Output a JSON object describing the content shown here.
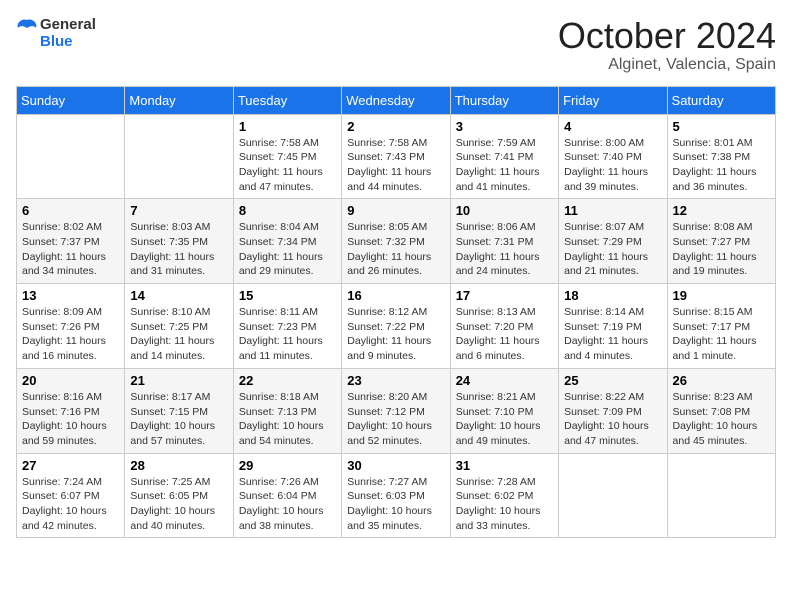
{
  "logo": {
    "text_general": "General",
    "text_blue": "Blue"
  },
  "header": {
    "month": "October 2024",
    "location": "Alginet, Valencia, Spain"
  },
  "weekdays": [
    "Sunday",
    "Monday",
    "Tuesday",
    "Wednesday",
    "Thursday",
    "Friday",
    "Saturday"
  ],
  "weeks": [
    [
      {
        "day": "",
        "sunrise": "",
        "sunset": "",
        "daylight": ""
      },
      {
        "day": "",
        "sunrise": "",
        "sunset": "",
        "daylight": ""
      },
      {
        "day": "1",
        "sunrise": "Sunrise: 7:58 AM",
        "sunset": "Sunset: 7:45 PM",
        "daylight": "Daylight: 11 hours and 47 minutes."
      },
      {
        "day": "2",
        "sunrise": "Sunrise: 7:58 AM",
        "sunset": "Sunset: 7:43 PM",
        "daylight": "Daylight: 11 hours and 44 minutes."
      },
      {
        "day": "3",
        "sunrise": "Sunrise: 7:59 AM",
        "sunset": "Sunset: 7:41 PM",
        "daylight": "Daylight: 11 hours and 41 minutes."
      },
      {
        "day": "4",
        "sunrise": "Sunrise: 8:00 AM",
        "sunset": "Sunset: 7:40 PM",
        "daylight": "Daylight: 11 hours and 39 minutes."
      },
      {
        "day": "5",
        "sunrise": "Sunrise: 8:01 AM",
        "sunset": "Sunset: 7:38 PM",
        "daylight": "Daylight: 11 hours and 36 minutes."
      }
    ],
    [
      {
        "day": "6",
        "sunrise": "Sunrise: 8:02 AM",
        "sunset": "Sunset: 7:37 PM",
        "daylight": "Daylight: 11 hours and 34 minutes."
      },
      {
        "day": "7",
        "sunrise": "Sunrise: 8:03 AM",
        "sunset": "Sunset: 7:35 PM",
        "daylight": "Daylight: 11 hours and 31 minutes."
      },
      {
        "day": "8",
        "sunrise": "Sunrise: 8:04 AM",
        "sunset": "Sunset: 7:34 PM",
        "daylight": "Daylight: 11 hours and 29 minutes."
      },
      {
        "day": "9",
        "sunrise": "Sunrise: 8:05 AM",
        "sunset": "Sunset: 7:32 PM",
        "daylight": "Daylight: 11 hours and 26 minutes."
      },
      {
        "day": "10",
        "sunrise": "Sunrise: 8:06 AM",
        "sunset": "Sunset: 7:31 PM",
        "daylight": "Daylight: 11 hours and 24 minutes."
      },
      {
        "day": "11",
        "sunrise": "Sunrise: 8:07 AM",
        "sunset": "Sunset: 7:29 PM",
        "daylight": "Daylight: 11 hours and 21 minutes."
      },
      {
        "day": "12",
        "sunrise": "Sunrise: 8:08 AM",
        "sunset": "Sunset: 7:27 PM",
        "daylight": "Daylight: 11 hours and 19 minutes."
      }
    ],
    [
      {
        "day": "13",
        "sunrise": "Sunrise: 8:09 AM",
        "sunset": "Sunset: 7:26 PM",
        "daylight": "Daylight: 11 hours and 16 minutes."
      },
      {
        "day": "14",
        "sunrise": "Sunrise: 8:10 AM",
        "sunset": "Sunset: 7:25 PM",
        "daylight": "Daylight: 11 hours and 14 minutes."
      },
      {
        "day": "15",
        "sunrise": "Sunrise: 8:11 AM",
        "sunset": "Sunset: 7:23 PM",
        "daylight": "Daylight: 11 hours and 11 minutes."
      },
      {
        "day": "16",
        "sunrise": "Sunrise: 8:12 AM",
        "sunset": "Sunset: 7:22 PM",
        "daylight": "Daylight: 11 hours and 9 minutes."
      },
      {
        "day": "17",
        "sunrise": "Sunrise: 8:13 AM",
        "sunset": "Sunset: 7:20 PM",
        "daylight": "Daylight: 11 hours and 6 minutes."
      },
      {
        "day": "18",
        "sunrise": "Sunrise: 8:14 AM",
        "sunset": "Sunset: 7:19 PM",
        "daylight": "Daylight: 11 hours and 4 minutes."
      },
      {
        "day": "19",
        "sunrise": "Sunrise: 8:15 AM",
        "sunset": "Sunset: 7:17 PM",
        "daylight": "Daylight: 11 hours and 1 minute."
      }
    ],
    [
      {
        "day": "20",
        "sunrise": "Sunrise: 8:16 AM",
        "sunset": "Sunset: 7:16 PM",
        "daylight": "Daylight: 10 hours and 59 minutes."
      },
      {
        "day": "21",
        "sunrise": "Sunrise: 8:17 AM",
        "sunset": "Sunset: 7:15 PM",
        "daylight": "Daylight: 10 hours and 57 minutes."
      },
      {
        "day": "22",
        "sunrise": "Sunrise: 8:18 AM",
        "sunset": "Sunset: 7:13 PM",
        "daylight": "Daylight: 10 hours and 54 minutes."
      },
      {
        "day": "23",
        "sunrise": "Sunrise: 8:20 AM",
        "sunset": "Sunset: 7:12 PM",
        "daylight": "Daylight: 10 hours and 52 minutes."
      },
      {
        "day": "24",
        "sunrise": "Sunrise: 8:21 AM",
        "sunset": "Sunset: 7:10 PM",
        "daylight": "Daylight: 10 hours and 49 minutes."
      },
      {
        "day": "25",
        "sunrise": "Sunrise: 8:22 AM",
        "sunset": "Sunset: 7:09 PM",
        "daylight": "Daylight: 10 hours and 47 minutes."
      },
      {
        "day": "26",
        "sunrise": "Sunrise: 8:23 AM",
        "sunset": "Sunset: 7:08 PM",
        "daylight": "Daylight: 10 hours and 45 minutes."
      }
    ],
    [
      {
        "day": "27",
        "sunrise": "Sunrise: 7:24 AM",
        "sunset": "Sunset: 6:07 PM",
        "daylight": "Daylight: 10 hours and 42 minutes."
      },
      {
        "day": "28",
        "sunrise": "Sunrise: 7:25 AM",
        "sunset": "Sunset: 6:05 PM",
        "daylight": "Daylight: 10 hours and 40 minutes."
      },
      {
        "day": "29",
        "sunrise": "Sunrise: 7:26 AM",
        "sunset": "Sunset: 6:04 PM",
        "daylight": "Daylight: 10 hours and 38 minutes."
      },
      {
        "day": "30",
        "sunrise": "Sunrise: 7:27 AM",
        "sunset": "Sunset: 6:03 PM",
        "daylight": "Daylight: 10 hours and 35 minutes."
      },
      {
        "day": "31",
        "sunrise": "Sunrise: 7:28 AM",
        "sunset": "Sunset: 6:02 PM",
        "daylight": "Daylight: 10 hours and 33 minutes."
      },
      {
        "day": "",
        "sunrise": "",
        "sunset": "",
        "daylight": ""
      },
      {
        "day": "",
        "sunrise": "",
        "sunset": "",
        "daylight": ""
      }
    ]
  ]
}
